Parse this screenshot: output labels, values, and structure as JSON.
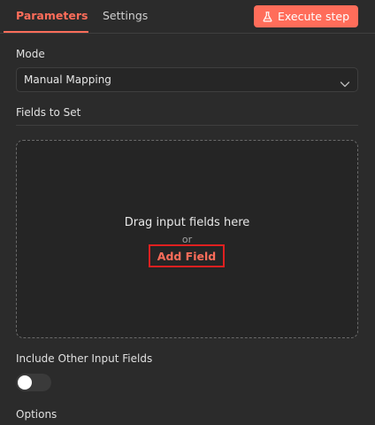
{
  "tabs": [
    {
      "label": "Parameters",
      "active": true
    },
    {
      "label": "Settings",
      "active": false
    }
  ],
  "execute_button": {
    "label": "Execute step",
    "icon": "flask-icon"
  },
  "mode": {
    "label": "Mode",
    "value": "Manual Mapping",
    "icon": "chevron-down-icon"
  },
  "fields": {
    "label": "Fields to Set",
    "drop_text": "Drag input fields here",
    "or_text": "or",
    "add_field_label": "Add Field"
  },
  "include_other": {
    "label": "Include Other Input Fields",
    "enabled": false
  },
  "options": {
    "label": "Options"
  },
  "colors": {
    "accent": "#ff6d5a",
    "background": "#2b2b2b",
    "highlight_border": "#e02020"
  }
}
